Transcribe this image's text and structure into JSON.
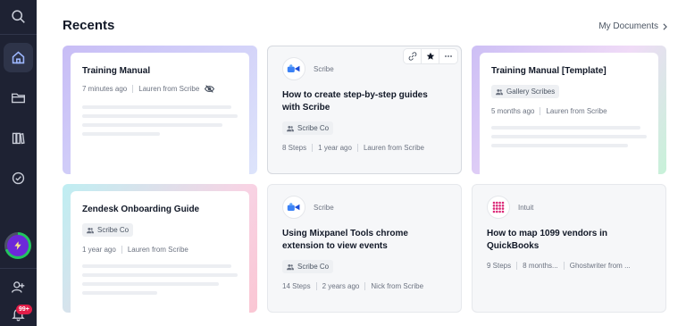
{
  "header": {
    "title": "Recents",
    "my_documents": "My Documents"
  },
  "sidebar": {
    "badge": "99+"
  },
  "cards": [
    {
      "title": "Training Manual",
      "time": "7 minutes ago",
      "author": "Lauren from Scribe"
    },
    {
      "source": "Scribe",
      "title": "How to create step-by-step guides with Scribe",
      "workspace": "Scribe Co",
      "steps": "8 Steps",
      "time": "1 year ago",
      "author": "Lauren from Scribe"
    },
    {
      "title": "Training Manual [Template]",
      "workspace": "Gallery Scribes",
      "time": "5 months ago",
      "author": "Lauren from Scribe"
    },
    {
      "title": "Zendesk Onboarding Guide",
      "workspace": "Scribe Co",
      "time": "1 year ago",
      "author": "Lauren from Scribe"
    },
    {
      "source": "Scribe",
      "title": "Using Mixpanel Tools chrome extension to view events",
      "workspace": "Scribe Co",
      "steps": "14 Steps",
      "time": "2 years ago",
      "author": "Nick from Scribe"
    },
    {
      "source": "Intuit",
      "title": "How to map 1099 vendors in QuickBooks",
      "steps": "9 Steps",
      "time": "8 months...",
      "author": "Ghostwriter from ..."
    }
  ],
  "colors": {
    "sidebar_bg": "#1e2233",
    "card_bg": "#f6f7f9",
    "badge": "#e11d48",
    "accent_purple": "#6d28d9",
    "progress_green": "#22c55e"
  }
}
